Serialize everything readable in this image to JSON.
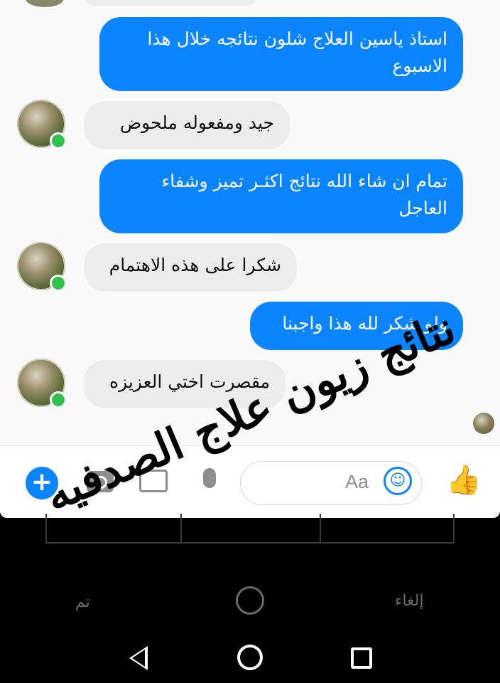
{
  "messages": [
    {
      "sender": "me",
      "text": "استاذ ياسين العلاج  شلون نتائجه خلال هذا الاسبوع"
    },
    {
      "sender": "contact",
      "text": "جيد ومفعوله ملحوض"
    },
    {
      "sender": "me",
      "text": "تمام ان شاء الله نتائج  اكثـر تميز وشفاء العاجل"
    },
    {
      "sender": "contact",
      "text": "شكرا على هذه الاهتمام"
    },
    {
      "sender": "me",
      "text": "ولو شكر لله هذا واجبنا"
    },
    {
      "sender": "contact",
      "text": "مقصرت اختي العزيزه"
    }
  ],
  "composer": {
    "placeholder": "Aa",
    "plus_icon": "plus-icon",
    "camera_icon": "camera-icon",
    "gallery_icon": "image-icon",
    "mic_icon": "microphone-icon",
    "emoji_icon": "smiley-icon",
    "like_icon": "thumbs-up-icon"
  },
  "watermark": {
    "line1": "نتائج زيون علاج الصدفيه"
  },
  "editor_bar": {
    "cancel_label": "إلغاء",
    "done_label": "تم",
    "rotate_icon": "rotate-icon"
  },
  "navigation": {
    "back_icon": "back-icon",
    "home_icon": "home-icon",
    "recent_icon": "recent-apps-icon"
  },
  "colors": {
    "outgoing_bubble": "#0a84ff",
    "incoming_bubble": "#ececec",
    "online_dot": "#31c24d"
  }
}
